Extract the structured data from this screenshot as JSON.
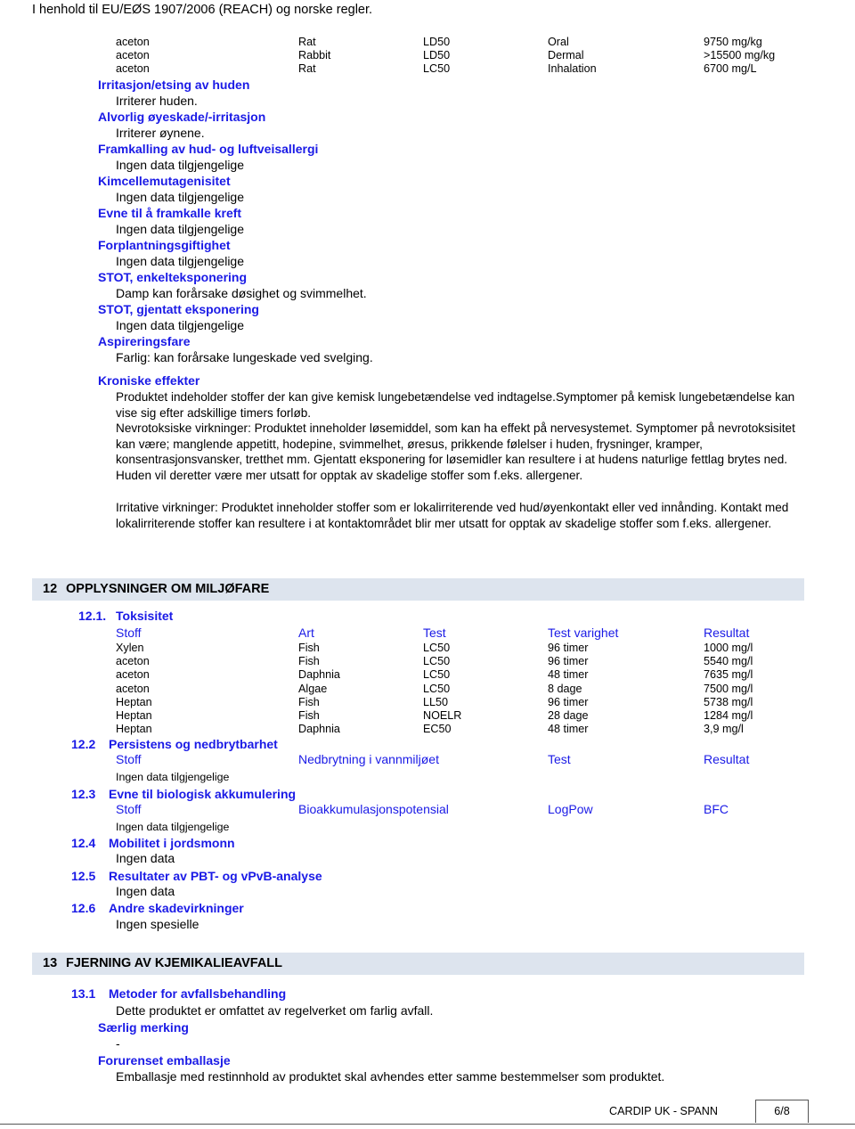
{
  "header": {
    "regulation_line": "I henhold til EU/EØS 1907/2006 (REACH) og norske regler."
  },
  "acute_tox_table": {
    "rows": [
      {
        "substance": "aceton",
        "species": "Rat",
        "test": "LD50",
        "route": "Oral",
        "result": "9750 mg/kg"
      },
      {
        "substance": "aceton",
        "species": "Rabbit",
        "test": "LD50",
        "route": "Dermal",
        "result": ">15500 mg/kg"
      },
      {
        "substance": "aceton",
        "species": "Rat",
        "test": "LC50",
        "route": "Inhalation",
        "result": "6700 mg/L"
      }
    ]
  },
  "health_effects": [
    {
      "heading": "Irritasjon/etsing av huden",
      "text": "Irriterer huden."
    },
    {
      "heading": "Alvorlig øyeskade/-irritasjon",
      "text": "Irriterer øynene."
    },
    {
      "heading": "Framkalling av hud- og luftveisallergi",
      "text": "Ingen data tilgjengelige"
    },
    {
      "heading": "Kimcellemutagenisitet",
      "text": "Ingen data tilgjengelige"
    },
    {
      "heading": "Evne til å framkalle kreft",
      "text": "Ingen data tilgjengelige"
    },
    {
      "heading": "Forplantningsgiftighet",
      "text": "Ingen data tilgjengelige"
    },
    {
      "heading": "STOT, enkelteksponering",
      "text": "Damp kan forårsake døsighet og svimmelhet."
    },
    {
      "heading": "STOT, gjentatt eksponering",
      "text": "Ingen data tilgjengelige"
    },
    {
      "heading": "Aspireringsfare",
      "text": "Farlig: kan forårsake lungeskade ved svelging."
    }
  ],
  "chronic": {
    "heading": "Kroniske effekter",
    "paragraphs": [
      "Produktet indeholder stoffer der kan give kemisk lungebetændelse ved indtagelse.Symptomer på kemisk lungebetændelse kan vise sig efter adskillige timers forløb.",
      "Nevrotoksiske virkninger:  Produktet inneholder løsemiddel, som kan ha effekt på nervesystemet. Symptomer på nevrotoksisitet kan være; manglende appetitt, hodepine, svimmelhet, øresus, prikkende følelser i huden, frysninger, kramper, konsentrasjonsvansker, tretthet mm. Gjentatt eksponering for løsemidler kan resultere i at hudens naturlige fettlag brytes ned. Huden vil deretter være mer utsatt for opptak av skadelige stoffer som f.eks. allergener.",
      "Irritative virkninger:  Produktet inneholder stoffer som er lokalirriterende ved hud/øyenkontakt eller ved innånding. Kontakt med lokalirriterende stoffer kan resultere i at kontaktområdet blir mer utsatt for opptak av skadelige stoffer som f.eks. allergener."
    ]
  },
  "section12": {
    "number": "12",
    "title": "OPPLYSNINGER OM MILJØFARE",
    "sub1": {
      "number": "12.1.",
      "title": "Toksisitet",
      "columns": [
        "Stoff",
        "Art",
        "Test",
        "Test varighet",
        "Resultat"
      ],
      "rows": [
        {
          "stoff": "Xylen",
          "art": "Fish",
          "test": "LC50",
          "varighet": "96 timer",
          "resultat": "1000 mg/l"
        },
        {
          "stoff": "aceton",
          "art": "Fish",
          "test": "LC50",
          "varighet": "96 timer",
          "resultat": "5540 mg/l"
        },
        {
          "stoff": "aceton",
          "art": "Daphnia",
          "test": "LC50",
          "varighet": "48 timer",
          "resultat": "7635 mg/l"
        },
        {
          "stoff": "aceton",
          "art": "Algae",
          "test": "LC50",
          "varighet": "8 dage",
          "resultat": "7500 mg/l"
        },
        {
          "stoff": "Heptan",
          "art": "Fish",
          "test": "LL50",
          "varighet": "96 timer",
          "resultat": "5738 mg/l"
        },
        {
          "stoff": "Heptan",
          "art": "Fish",
          "test": "NOELR",
          "varighet": "28 dage",
          "resultat": "1284 mg/l"
        },
        {
          "stoff": "Heptan",
          "art": "Daphnia",
          "test": "EC50",
          "varighet": "48 timer",
          "resultat": "3,9 mg/l"
        }
      ]
    },
    "sub2": {
      "number": "12.2",
      "title": "Persistens og nedbrytbarhet",
      "columns": [
        "Stoff",
        "Nedbrytning i vannmiljøet",
        "Test",
        "Resultat"
      ],
      "note": "Ingen data tilgjengelige"
    },
    "sub3": {
      "number": "12.3",
      "title": "Evne til biologisk akkumulering",
      "columns": [
        "Stoff",
        "Bioakkumulasjonspotensial",
        "LogPow",
        "BFC"
      ],
      "note": "Ingen data tilgjengelige"
    },
    "sub4": {
      "number": "12.4",
      "title": "Mobilitet i jordsmonn",
      "text": "Ingen data"
    },
    "sub5": {
      "number": "12.5",
      "title": "Resultater av PBT- og vPvB-analyse",
      "text": "Ingen data"
    },
    "sub6": {
      "number": "12.6",
      "title": "Andre skadevirkninger",
      "text": "Ingen spesielle"
    }
  },
  "section13": {
    "number": "13",
    "title": "FJERNING AV KJEMIKALIEAVFALL",
    "sub1": {
      "number": "13.1",
      "title": "Metoder for avfallsbehandling",
      "text": "Dette produktet er omfattet av regelverket om farlig avfall."
    },
    "marking": {
      "heading": "Særlig merking",
      "text": "-"
    },
    "packaging": {
      "heading": "Forurenset emballasje",
      "text": "Emballasje med restinnhold av produktet skal avhendes etter samme bestemmelser som produktet."
    }
  },
  "footer": {
    "document_name": "CARDIP UK - SPANN",
    "page": "6/8"
  },
  "colors": {
    "heading_blue": "#1a1ae6",
    "band_background": "#dde4ee",
    "text_black": "#000000"
  }
}
